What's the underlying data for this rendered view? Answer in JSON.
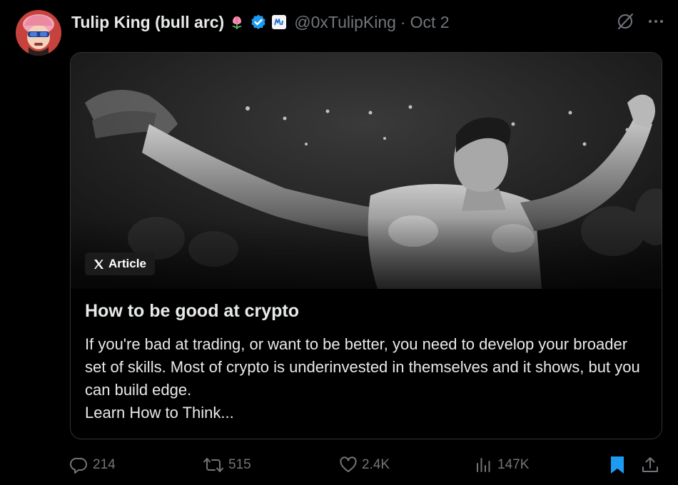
{
  "tweet": {
    "display_name": "Tulip King (bull arc)",
    "handle": "@0xTulipKing",
    "separator": "·",
    "date": "Oct 2"
  },
  "article": {
    "badge_label": "Article",
    "title": "How to be good at crypto",
    "description": "If you're bad at trading, or want to be better, you need to develop your broader set of skills. Most of crypto is underinvested in themselves and it shows, but you can build edge.\nLearn How to Think..."
  },
  "stats": {
    "replies": "214",
    "reposts": "515",
    "likes": "2.4K",
    "views": "147K"
  },
  "colors": {
    "background": "#000000",
    "text_primary": "#e7e9ea",
    "text_secondary": "#71767b",
    "verified_blue": "#1d9bf0",
    "bookmark_active": "#1d9bf0",
    "border": "#2f3336"
  },
  "icons": {
    "tulip": "tulip-emoji-icon",
    "verified": "verified-badge-icon",
    "affiliate": "affiliate-badge-icon",
    "grok": "grok-icon",
    "more": "more-icon",
    "x_logo": "x-logo-icon",
    "reply": "reply-icon",
    "repost": "repost-icon",
    "like": "like-icon",
    "views": "views-icon",
    "bookmark": "bookmark-icon",
    "share": "share-icon"
  }
}
